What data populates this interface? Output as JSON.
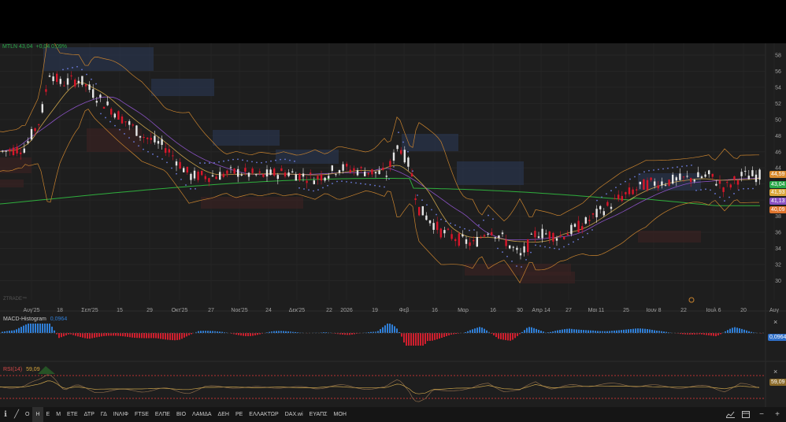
{
  "header": {
    "symbol": "MTLN",
    "price": "43,04",
    "change": "+0,04",
    "change_pct": "0,09%"
  },
  "watermark": "ZTRADE™",
  "price_axis": {
    "ticks": [
      "58",
      "56",
      "54",
      "52",
      "50",
      "48",
      "46",
      "44",
      "42",
      "40",
      "38",
      "36",
      "34",
      "32",
      "30"
    ],
    "labels": [
      {
        "text": "44,59",
        "color": "#d98a2e"
      },
      {
        "text": "43,04",
        "color": "#2aa84a"
      },
      {
        "text": "41,93",
        "color": "#d9a63a"
      },
      {
        "text": "41,13",
        "color": "#8a52c4"
      },
      {
        "text": "40,09",
        "color": "#e0752e"
      }
    ]
  },
  "time_axis": [
    "Αυγ'25",
    "18",
    "Σεπ'25",
    "15",
    "29",
    "Οκτ'25",
    "27",
    "Νοε'25",
    "24",
    "Δεκ'25",
    "22",
    "2026",
    "19",
    "Φεβ",
    "16",
    "Μαρ",
    "16",
    "30",
    "Απρ 14",
    "27",
    "Μαι 11",
    "25",
    "Ιουν 8",
    "22",
    "Ιουλ 6",
    "20",
    "Αυγ"
  ],
  "macd": {
    "title": "MACD-Histogram",
    "value": "0,0964",
    "close": "×"
  },
  "rsi": {
    "title": "RSI(14)",
    "value": "59,09",
    "close": "×"
  },
  "colors": {
    "up": "#e6e6e6",
    "down": "#d8162a",
    "macd_pos": "#2f7fd8",
    "macd_neg": "#d01f2e",
    "ma200": "#2fae3d",
    "ma_fast": "#8a52c4",
    "bb": "#c9832e"
  },
  "toolbar": {
    "info_icon": "info-icon",
    "draw_icon": "pencil-icon",
    "timeframes": [
      "Ο",
      "Η",
      "Ε",
      "Μ"
    ],
    "active": "Η",
    "symbols": [
      "ΕΤΕ",
      "ΔΤΡ",
      "ΓΔ",
      "ΙΝΛΙΦ",
      "FTSE",
      "ΕΛΠΕ",
      "ΒΙΟ",
      "ΛΑΜΔΑ",
      "ΔΕΗ",
      "ΡΕ",
      "ΕΛΛΑΚΤΩΡ",
      "DAX.wi",
      "ΕΥΑΠΣ",
      "ΜΟΗ"
    ],
    "right_icons": [
      "chart-settings-icon",
      "window-icon",
      "zoom-out-icon",
      "zoom-in-icon"
    ]
  }
}
